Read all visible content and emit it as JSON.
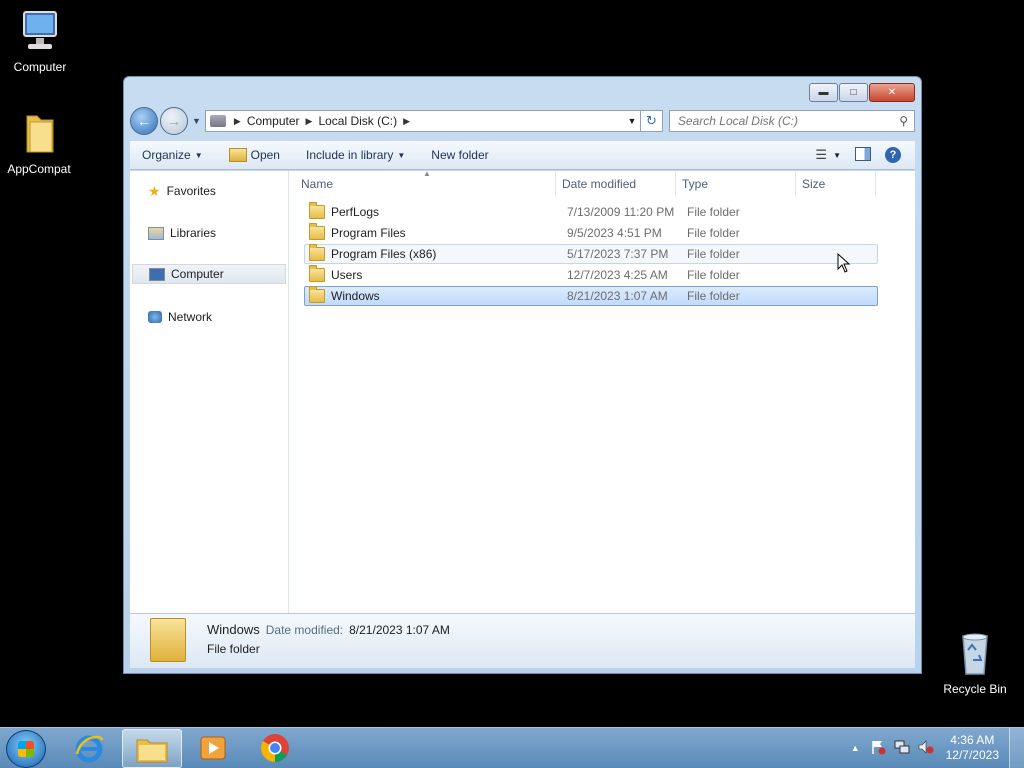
{
  "desktop": {
    "icons": [
      {
        "label": "Computer",
        "icon": "computer-icon"
      },
      {
        "label": "AppCompat",
        "icon": "folder-icon"
      },
      {
        "label": "Recycle Bin",
        "icon": "recycle-bin-icon"
      }
    ]
  },
  "window": {
    "address": {
      "crumbs": [
        "Computer",
        "Local Disk (C:)"
      ]
    },
    "search": {
      "placeholder": "Search Local Disk (C:)"
    },
    "toolbar": {
      "organize": "Organize",
      "open": "Open",
      "include_in_library": "Include in library",
      "new_folder": "New folder"
    },
    "navpane": {
      "items": [
        {
          "label": "Favorites",
          "icon": "star-icon"
        },
        {
          "label": "Libraries",
          "icon": "libraries-icon"
        },
        {
          "label": "Computer",
          "icon": "computer-icon",
          "selected": true
        },
        {
          "label": "Network",
          "icon": "network-icon"
        }
      ]
    },
    "columns": [
      "Name",
      "Date modified",
      "Type",
      "Size"
    ],
    "files": [
      {
        "name": "PerfLogs",
        "date": "7/13/2009 11:20 PM",
        "type": "File folder"
      },
      {
        "name": "Program Files",
        "date": "9/5/2023 4:51 PM",
        "type": "File folder"
      },
      {
        "name": "Program Files (x86)",
        "date": "5/17/2023 7:37 PM",
        "type": "File folder",
        "hover": true
      },
      {
        "name": "Users",
        "date": "12/7/2023 4:25 AM",
        "type": "File folder"
      },
      {
        "name": "Windows",
        "date": "8/21/2023 1:07 AM",
        "type": "File folder",
        "selected": true
      }
    ],
    "details": {
      "name": "Windows",
      "date_label": "Date modified:",
      "date_value": "8/21/2023 1:07 AM",
      "type": "File folder"
    }
  },
  "taskbar": {
    "apps": [
      "internet-explorer-icon",
      "windows-explorer-icon",
      "media-player-icon",
      "chrome-icon"
    ],
    "clock": {
      "time": "4:36 AM",
      "date": "12/7/2023"
    }
  }
}
